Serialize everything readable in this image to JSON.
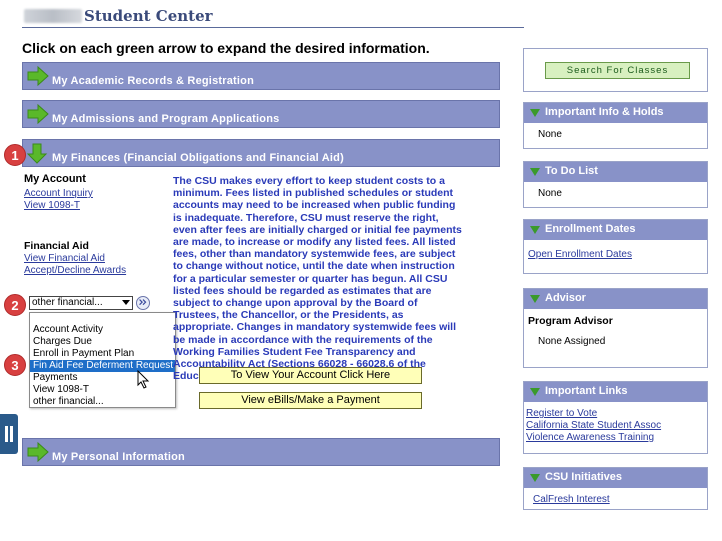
{
  "header": {
    "title": "Student Center"
  },
  "instructions": "Click on each green arrow to expand the desired information.",
  "sections": {
    "academic": "My Academic Records & Registration",
    "admissions": "My Admissions and Program Applications",
    "finances": "My Finances (Financial Obligations and Financial Aid)",
    "personal": "My Personal Information"
  },
  "my_account": {
    "heading": "My Account",
    "links": [
      "Account Inquiry",
      "View 1098-T"
    ]
  },
  "financial_aid": {
    "heading": "Financial Aid",
    "links": [
      "View Financial Aid",
      "Accept/Decline Awards"
    ]
  },
  "select": {
    "value": "other financial..."
  },
  "dropdown": {
    "options": [
      "Account Activity",
      "Charges Due",
      "Enroll in Payment Plan",
      "Fin Aid Fee Deferment Request",
      "Payments",
      "View 1098-T",
      "other financial..."
    ],
    "selected_index": 3
  },
  "disclaimer": "The CSU makes every effort to keep student costs to a minimum. Fees listed in published schedules or student accounts may need to be increased when public funding is inadequate. Therefore, CSU must reserve the right, even after fees are initially charged or initial fee payments are made, to increase or modify any listed fees. All listed fees, other than mandatory systemwide fees, are subject to change without notice, until the date when instruction for a particular semester or quarter has begun. All CSU listed fees should be regarded as estimates that are subject to change upon approval by the Board of Trustees, the Chancellor, or the Presidents, as appropriate. Changes in mandatory systemwide fees will be made in accordance with the requirements of the Working Families Student Fee Transparency and Accountability Act (Sections 66028 - 66028.6 of the Education Code).",
  "buttons": {
    "view_account": "To View Your Account Click Here",
    "view_ebills": "View eBills/Make a Payment",
    "search_classes": "Search For Classes"
  },
  "markers": [
    "1",
    "2",
    "3"
  ],
  "sidebar": {
    "important_info": {
      "title": "Important Info & Holds",
      "body": "None"
    },
    "todo": {
      "title": "To Do List",
      "body": "None"
    },
    "enrollment": {
      "title": "Enrollment Dates",
      "link": "Open Enrollment Dates"
    },
    "advisor": {
      "title": "Advisor",
      "label": "Program Advisor",
      "value": "None Assigned"
    },
    "important_links": {
      "title": "Important Links",
      "links": [
        "Register to Vote",
        "California State Student Assoc",
        "Violence Awareness Training"
      ]
    },
    "csu_initiatives": {
      "title": "CSU Initiatives",
      "link": "CalFresh Interest"
    }
  },
  "colors": {
    "section_bar": "#8892c8",
    "arrow_green": "#5ab82a",
    "marker_red": "#d84040",
    "link_blue": "#2a3a9c"
  },
  "icons": {
    "expand": "green-arrow-icon",
    "sidebar_toggle": "triangle-down-icon",
    "go": "double-chevron-icon"
  }
}
